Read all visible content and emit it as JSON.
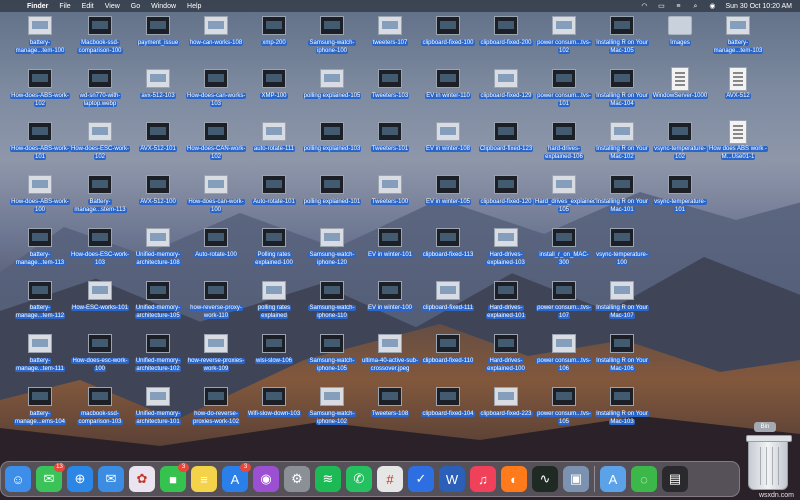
{
  "menubar": {
    "app_name": "Finder",
    "items": [
      "File",
      "Edit",
      "View",
      "Go",
      "Window",
      "Help"
    ],
    "status_icons": [
      "apple-logo",
      "wifi-icon",
      "battery-icon",
      "control-center-icon",
      "spotlight-icon",
      "siri-icon"
    ],
    "clock": "Sun 30 Oct  10:20 AM"
  },
  "desktop": {
    "columns": [
      [
        "battery-manage...tem-100",
        "How-does-ABS-work-102",
        "How-does-ABS-work-101",
        "How-does-ABS-work-100",
        "battery-manage...tem-113",
        "battery-manage...tem-112",
        "battery-manage...tem-111",
        "battery-manage...ems-104"
      ],
      [
        "Macbook-ssd-comparison-100",
        "wd-sn770-with-laptop.webp",
        "How-does-ESC-work-102",
        "Battery-manage...stem-113",
        "How-does-ESC-work-103",
        "How-ESC-works-101",
        "How-does-esc-work-100",
        "macbook-ssd-comparison-103"
      ],
      [
        "payment_issue",
        "avx-512-103",
        "AVX-512-101",
        "AVX-512-100",
        "Unified-memory-architecture-108",
        "Unified-memory-architecture-105",
        "Unified-memory-architecture-102",
        "Unified-memory-architecture-101"
      ],
      [
        "how-can-works-108",
        "How-does-can-works-103",
        "How-does-CAN-work-102",
        "How-does-can-work-100",
        "Auto-rotate-100",
        "how-reverse-proxy-work-110",
        "how-reverse-proxies-work-109",
        "how-do-reverse-proxies-work-102"
      ],
      [
        "xmp-200",
        "XMP-100",
        "auto-rotate-111",
        "Auto-rotate-101",
        "Polling rates explained-100",
        "polling rates explained",
        "wisi-slow-106",
        "Wifi-slow-down-103"
      ],
      [
        "Samsung-watch-iphone-100",
        "polling explained-105",
        "polling explained-103",
        "polling explained-101",
        "Samsung-watch-iphone-120",
        "Samsung-watch-iphone-110",
        "Samsung-watch-iphone-105",
        "Samsung-watch-iphone-102"
      ],
      [
        "tweeters-107",
        "Tweeters-103",
        "Tweeters-101",
        "Tweeters-100",
        "EV in winter-101",
        "EV in winter-100",
        "ultima-40-active-sub-crossover.jpeg",
        "Tweeters-108"
      ],
      [
        "clipboard-fixed-100",
        "EV in winter-110",
        "EV in winter-108",
        "EV in winter-105",
        "clipboard-fixed-113",
        "clipboard-fixed-111",
        "clipboard-fixed-110",
        "clipboard-fixed-104"
      ],
      [
        "clipboard-fixed-200",
        "clipboard-fixed-129",
        "Clipboard-fixed-123",
        "clipboard-fixed-120",
        "Hard-drives-explained-103",
        "Hard-drives-explained-101",
        "Hard-drives-explained-100",
        "clipboard-fixed-223"
      ],
      [
        "power consum...tvs-102",
        "power consum...tvs-101",
        "hard-drives-explained-106",
        "Hard_drives_explained-105",
        "install_r_on_MAC-300",
        "power consum...tvs-107",
        "power consum...tvs-106",
        "power consum...tvs-105"
      ],
      [
        "Installing R on Your Mac-105",
        "Installing R on Your Mac-104",
        "Installing R on Your Mac-102",
        "Installing R on Your Mac-101",
        "vsync-temperature-100",
        "Installing R on Your Mac-107",
        "Installing R on Your Mac-106",
        "Installing R on Your Mac-103"
      ],
      [
        "Images",
        "WindowServer-1000",
        "vsync-temperature-102",
        "vsync-temperature-101",
        "",
        "",
        "",
        ""
      ],
      [
        "battery-manage...tem-103",
        "AVX-512",
        "How does ABS work - M...Use01-1",
        "",
        "",
        "",
        "",
        ""
      ]
    ]
  },
  "dock": {
    "apps": [
      {
        "name": "finder",
        "glyph": "☺",
        "color": "#3d8ee8"
      },
      {
        "name": "messages",
        "glyph": "✉",
        "color": "#3bc35a",
        "badge": "13"
      },
      {
        "name": "safari",
        "glyph": "⊕",
        "color": "#2b86e6"
      },
      {
        "name": "mail",
        "glyph": "✉",
        "color": "#3a8de2"
      },
      {
        "name": "photos",
        "glyph": "✿",
        "color": "#e9e4ef"
      },
      {
        "name": "facetime",
        "glyph": "■",
        "color": "#35c24f",
        "badge": "3"
      },
      {
        "name": "notes",
        "glyph": "≡",
        "color": "#f4d24a"
      },
      {
        "name": "app-store",
        "glyph": "A",
        "color": "#2a7fe8",
        "badge": "3"
      },
      {
        "name": "podcasts",
        "glyph": "◉",
        "color": "#9b4fd1"
      },
      {
        "name": "system-preferences",
        "glyph": "⚙",
        "color": "#8b8f96"
      },
      {
        "name": "spotify",
        "glyph": "≋",
        "color": "#1db954"
      },
      {
        "name": "whatsapp",
        "glyph": "✆",
        "color": "#25c060"
      },
      {
        "name": "slack",
        "glyph": "#",
        "color": "#e6e6e6"
      },
      {
        "name": "microsoft-to-do",
        "glyph": "✓",
        "color": "#2d6fe0"
      },
      {
        "name": "microsoft-word",
        "glyph": "W",
        "color": "#2b5fb8"
      },
      {
        "name": "music",
        "glyph": "♫",
        "color": "#f0405a"
      },
      {
        "name": "firefox",
        "glyph": "◐",
        "color": "#ff7a1a"
      },
      {
        "name": "activity-monitor",
        "glyph": "∿",
        "color": "#1f2a24"
      },
      {
        "name": "preview",
        "glyph": "▣",
        "color": "#7b93b1"
      },
      {
        "name": "applications-folder",
        "glyph": "A",
        "color": "#5ba2e8"
      },
      {
        "name": "downloads-stack",
        "glyph": "◌",
        "color": "#3cb84a"
      },
      {
        "name": "recent-screenshot",
        "glyph": "▤",
        "color": "#2a2a2e"
      }
    ]
  },
  "bin": {
    "label": "Bin"
  },
  "watermark": "wsxdn.com"
}
